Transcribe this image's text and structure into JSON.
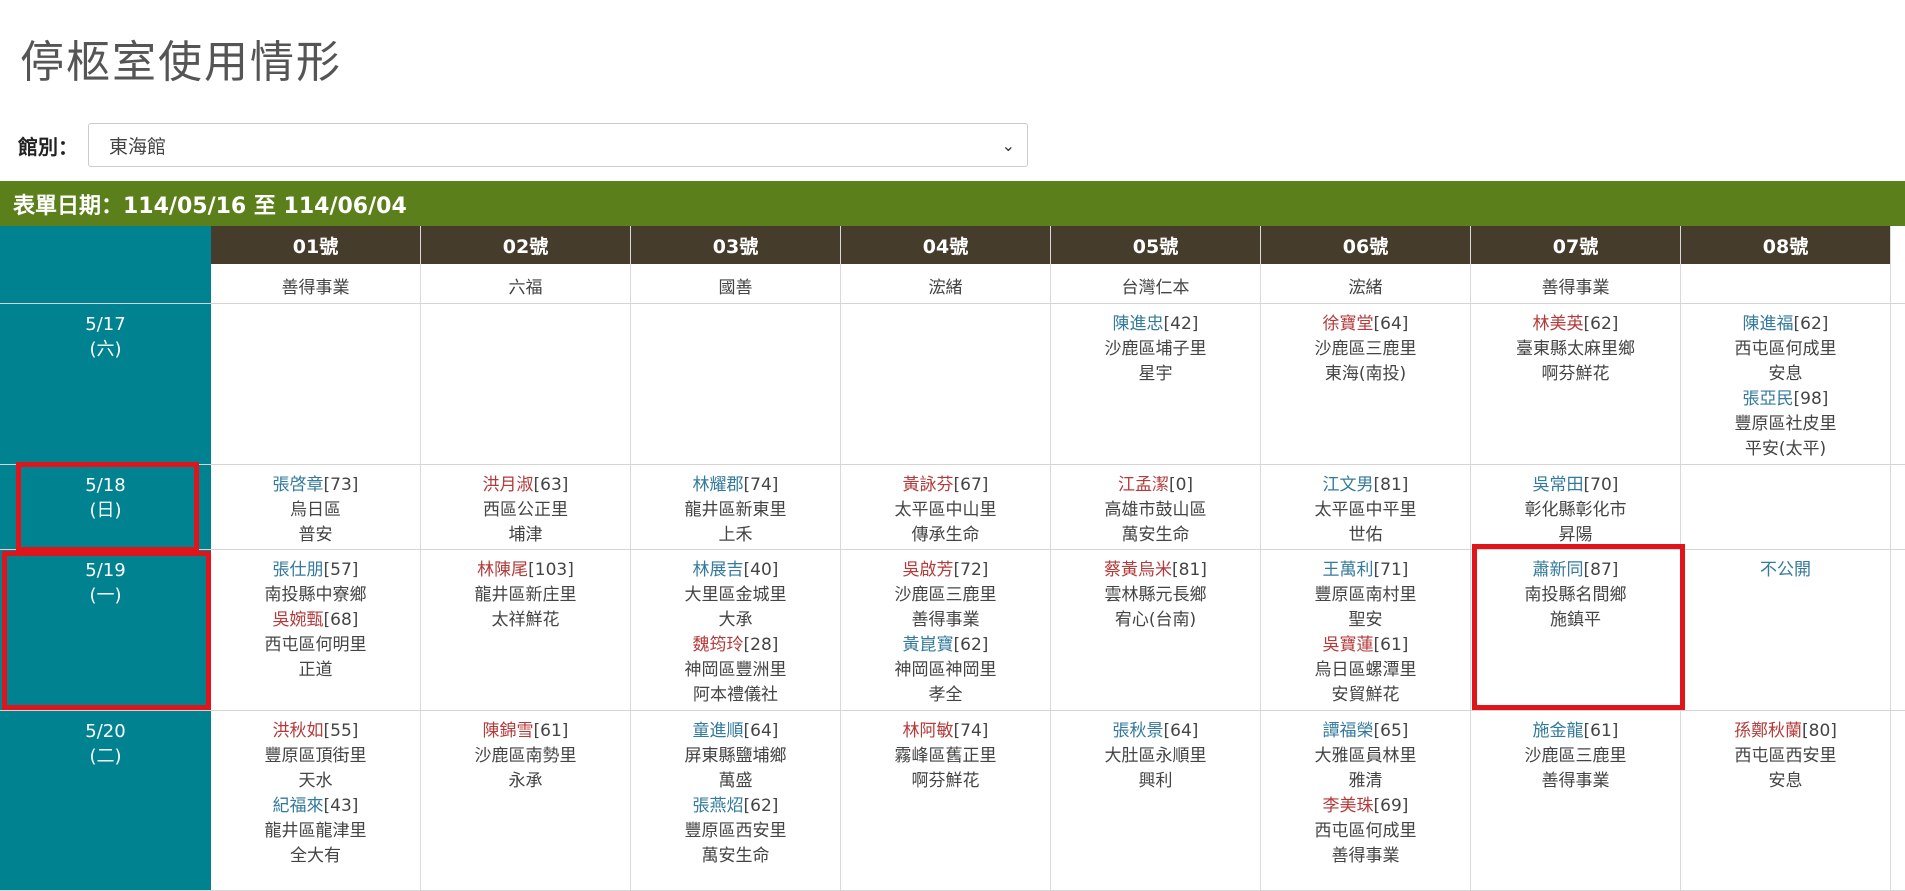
{
  "page": {
    "title": "停柩室使用情形"
  },
  "filter": {
    "label": "館別：",
    "selected": "東海館"
  },
  "date_range": {
    "text": "表單日期：114/05/16 至 114/06/04"
  },
  "columns": [
    "01號",
    "02號",
    "03號",
    "04號",
    "05號",
    "06號",
    "07號",
    "08號"
  ],
  "rows": [
    {
      "date": "",
      "weekday": "",
      "cells": [
        [
          {
            "line": "善得事業"
          }
        ],
        [
          {
            "line": "六福"
          }
        ],
        [
          {
            "line": "國善"
          }
        ],
        [
          {
            "line": "浤緒"
          }
        ],
        [
          {
            "line": "台灣仁本"
          }
        ],
        [
          {
            "line": "浤緒"
          }
        ],
        [
          {
            "line": "善得事業"
          }
        ],
        []
      ]
    },
    {
      "date": "5/17",
      "weekday": "(六)",
      "cells": [
        [],
        [],
        [],
        [],
        [
          {
            "name": "陳進忠",
            "age": "[42]",
            "color": "blue",
            "place": "沙鹿區埔子里",
            "company": "星宇"
          }
        ],
        [
          {
            "name": "徐寶堂",
            "age": "[64]",
            "color": "red",
            "place": "沙鹿區三鹿里",
            "company": "東海(南投)"
          }
        ],
        [
          {
            "name": "林美英",
            "age": "[62]",
            "color": "red",
            "place": "臺東縣太麻里鄉",
            "company": "啊芬鮮花"
          }
        ],
        [
          {
            "name": "陳進福",
            "age": "[62]",
            "color": "blue",
            "place": "西屯區何成里",
            "company": "安息"
          },
          {
            "name": "張亞民",
            "age": "[98]",
            "color": "blue",
            "place": "豐原區社皮里",
            "company": "平安(太平)"
          }
        ]
      ]
    },
    {
      "date": "5/18",
      "weekday": "(日)",
      "cells": [
        [
          {
            "name": "張啓章",
            "age": "[73]",
            "color": "blue",
            "place": "烏日區",
            "company": "普安"
          }
        ],
        [
          {
            "name": "洪月淑",
            "age": "[63]",
            "color": "red",
            "place": "西區公正里",
            "company": "埔津"
          }
        ],
        [
          {
            "name": "林耀郡",
            "age": "[74]",
            "color": "blue",
            "place": "龍井區新東里",
            "company": "上禾"
          }
        ],
        [
          {
            "name": "黃詠芬",
            "age": "[67]",
            "color": "red",
            "place": "太平區中山里",
            "company": "傳承生命"
          }
        ],
        [
          {
            "name": "江孟潔",
            "age": "[0]",
            "color": "red",
            "place": "高雄市鼓山區",
            "company": "萬安生命"
          }
        ],
        [
          {
            "name": "江文男",
            "age": "[81]",
            "color": "blue",
            "place": "太平區中平里",
            "company": "世佑"
          }
        ],
        [
          {
            "name": "吳常田",
            "age": "[70]",
            "color": "blue",
            "place": "彰化縣彰化市",
            "company": "昇陽"
          }
        ],
        []
      ]
    },
    {
      "date": "5/19",
      "weekday": "(一)",
      "cells": [
        [
          {
            "name": "張仕朋",
            "age": "[57]",
            "color": "blue",
            "place": "南投縣中寮鄉",
            "company": ""
          },
          {
            "name": "吳婉甄",
            "age": "[68]",
            "color": "red",
            "place": "西屯區何明里",
            "company": "正道"
          }
        ],
        [
          {
            "name": "林陳尾",
            "age": "[103]",
            "color": "red",
            "place": "龍井區新庄里",
            "company": "太祥鮮花"
          }
        ],
        [
          {
            "name": "林展吉",
            "age": "[40]",
            "color": "blue",
            "place": "大里區金城里",
            "company": "大承"
          },
          {
            "name": "魏筠玲",
            "age": "[28]",
            "color": "red",
            "place": "神岡區豐洲里",
            "company": "阿本禮儀社"
          }
        ],
        [
          {
            "name": "吳啟芳",
            "age": "[72]",
            "color": "red",
            "place": "沙鹿區三鹿里",
            "company": "善得事業"
          },
          {
            "name": "黃崑寶",
            "age": "[62]",
            "color": "blue",
            "place": "神岡區神岡里",
            "company": "孝全"
          }
        ],
        [
          {
            "name": "蔡黃烏米",
            "age": "[81]",
            "color": "red",
            "place": "雲林縣元長鄉",
            "company": "宥心(台南)"
          }
        ],
        [
          {
            "name": "王萬利",
            "age": "[71]",
            "color": "blue",
            "place": "豐原區南村里",
            "company": "聖安"
          },
          {
            "name": "吳寶蓮",
            "age": "[61]",
            "color": "red",
            "place": "烏日區螺潭里",
            "company": "安貿鮮花"
          }
        ],
        [
          {
            "name": "蕭新同",
            "age": "[87]",
            "color": "blue",
            "place": "南投縣名間鄉",
            "company": "施鎮平"
          }
        ],
        [
          {
            "public": "不公開"
          }
        ]
      ]
    },
    {
      "date": "5/20",
      "weekday": "(二)",
      "cells": [
        [
          {
            "name": "洪秋如",
            "age": "[55]",
            "color": "red",
            "place": "豐原區頂街里",
            "company": "天水"
          },
          {
            "name": "紀福來",
            "age": "[43]",
            "color": "blue",
            "place": "龍井區龍津里",
            "company": "全大有"
          }
        ],
        [
          {
            "name": "陳錦雪",
            "age": "[61]",
            "color": "red",
            "place": "沙鹿區南勢里",
            "company": "永承"
          }
        ],
        [
          {
            "name": "童進順",
            "age": "[64]",
            "color": "blue",
            "place": "屏東縣鹽埔鄉",
            "company": "萬盛"
          },
          {
            "name": "張燕炤",
            "age": "[62]",
            "color": "blue",
            "place": "豐原區西安里",
            "company": "萬安生命"
          }
        ],
        [
          {
            "name": "林阿敏",
            "age": "[74]",
            "color": "red",
            "place": "霧峰區舊正里",
            "company": "啊芬鮮花"
          }
        ],
        [
          {
            "name": "張秋景",
            "age": "[64]",
            "color": "blue",
            "place": "大肚區永順里",
            "company": "興利"
          }
        ],
        [
          {
            "name": "譚福榮",
            "age": "[65]",
            "color": "blue",
            "place": "大雅區員林里",
            "company": "雅清"
          },
          {
            "name": "李美珠",
            "age": "[69]",
            "color": "red",
            "place": "西屯區何成里",
            "company": "善得事業"
          }
        ],
        [
          {
            "name": "施金龍",
            "age": "[61]",
            "color": "blue",
            "place": "沙鹿區三鹿里",
            "company": "善得事業"
          }
        ],
        [
          {
            "name": "孫鄭秋蘭",
            "age": "[80]",
            "color": "red",
            "place": "西屯區西安里",
            "company": "安息"
          }
        ]
      ]
    }
  ],
  "colors": {
    "date_bar": "#5b7f1a",
    "date_column": "#008291",
    "header": "#453c2b",
    "name_blue": "#337a9c",
    "name_red": "#b53a3a",
    "highlight_box": "#e0141b"
  }
}
